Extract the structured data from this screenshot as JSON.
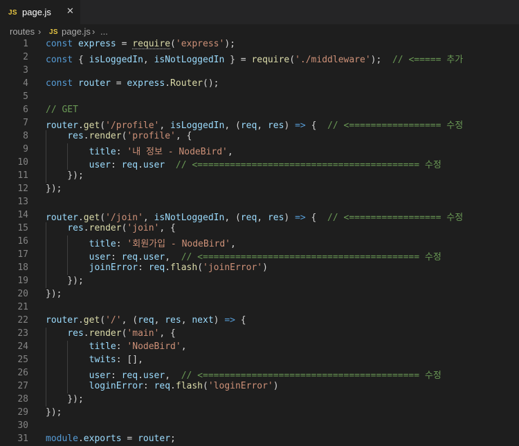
{
  "tab": {
    "icon": "JS",
    "label": "page.js",
    "close": "✕"
  },
  "breadcrumb": {
    "folder": "routes",
    "sep1": "›",
    "icon": "JS",
    "file": "page.js",
    "sep2": "›",
    "more": "..."
  },
  "colors": {
    "background": "#1e1e1e",
    "keyword": "#569cd6",
    "variable": "#9cdcfe",
    "function": "#dcdcaa",
    "string": "#ce9178",
    "comment": "#6a9955",
    "text": "#d4d4d4"
  },
  "lines": [
    {
      "n": "1",
      "t": [
        [
          "kw",
          "const "
        ],
        [
          "var",
          "express"
        ],
        [
          "pl",
          " = "
        ],
        [
          "fn",
          "require",
          "squig"
        ],
        [
          "pl",
          "("
        ],
        [
          "str",
          "'express'"
        ],
        [
          "pl",
          ");"
        ]
      ]
    },
    {
      "n": "2",
      "t": [
        [
          "kw",
          "const "
        ],
        [
          "pl",
          "{ "
        ],
        [
          "var",
          "isLoggedIn"
        ],
        [
          "pl",
          ", "
        ],
        [
          "var",
          "isNotLoggedIn"
        ],
        [
          "pl",
          " } = "
        ],
        [
          "fn",
          "require"
        ],
        [
          "pl",
          "("
        ],
        [
          "str",
          "'./middleware'"
        ],
        [
          "pl",
          ");  "
        ],
        [
          "cm",
          "// <===== 추가"
        ]
      ]
    },
    {
      "n": "3",
      "t": []
    },
    {
      "n": "4",
      "t": [
        [
          "kw",
          "const "
        ],
        [
          "var",
          "router"
        ],
        [
          "pl",
          " = "
        ],
        [
          "var",
          "express"
        ],
        [
          "pl",
          "."
        ],
        [
          "fn",
          "Router"
        ],
        [
          "pl",
          "();"
        ]
      ]
    },
    {
      "n": "5",
      "t": []
    },
    {
      "n": "6",
      "t": [
        [
          "cm",
          "// GET"
        ]
      ]
    },
    {
      "n": "7",
      "t": [
        [
          "var",
          "router"
        ],
        [
          "pl",
          "."
        ],
        [
          "fn",
          "get"
        ],
        [
          "pl",
          "("
        ],
        [
          "str",
          "'/profile'"
        ],
        [
          "pl",
          ", "
        ],
        [
          "var",
          "isLoggedIn"
        ],
        [
          "pl",
          ", ("
        ],
        [
          "var",
          "req"
        ],
        [
          "pl",
          ", "
        ],
        [
          "var",
          "res"
        ],
        [
          "pl",
          ") "
        ],
        [
          "kw",
          "=>"
        ],
        [
          "pl",
          " {  "
        ],
        [
          "cm",
          "// <================= 수정"
        ]
      ]
    },
    {
      "n": "8",
      "t": [
        [
          "pl",
          "    "
        ],
        [
          "var",
          "res"
        ],
        [
          "pl",
          "."
        ],
        [
          "fn",
          "render"
        ],
        [
          "pl",
          "("
        ],
        [
          "str",
          "'profile'"
        ],
        [
          "pl",
          ", {"
        ]
      ]
    },
    {
      "n": "9",
      "t": [
        [
          "pl",
          "        "
        ],
        [
          "var",
          "title"
        ],
        [
          "pl",
          ": "
        ],
        [
          "str",
          "'내 정보 - NodeBird'"
        ],
        [
          "pl",
          ","
        ]
      ]
    },
    {
      "n": "10",
      "t": [
        [
          "pl",
          "        "
        ],
        [
          "var",
          "user"
        ],
        [
          "pl",
          ": "
        ],
        [
          "var",
          "req"
        ],
        [
          "pl",
          "."
        ],
        [
          "var",
          "user"
        ],
        [
          "pl",
          "  "
        ],
        [
          "cm",
          "// <========================================= 수정"
        ]
      ]
    },
    {
      "n": "11",
      "t": [
        [
          "pl",
          "    });"
        ]
      ]
    },
    {
      "n": "12",
      "t": [
        [
          "pl",
          "});"
        ]
      ]
    },
    {
      "n": "13",
      "t": []
    },
    {
      "n": "14",
      "t": [
        [
          "var",
          "router"
        ],
        [
          "pl",
          "."
        ],
        [
          "fn",
          "get"
        ],
        [
          "pl",
          "("
        ],
        [
          "str",
          "'/join'"
        ],
        [
          "pl",
          ", "
        ],
        [
          "var",
          "isNotLoggedIn"
        ],
        [
          "pl",
          ", ("
        ],
        [
          "var",
          "req"
        ],
        [
          "pl",
          ", "
        ],
        [
          "var",
          "res"
        ],
        [
          "pl",
          ") "
        ],
        [
          "kw",
          "=>"
        ],
        [
          "pl",
          " {  "
        ],
        [
          "cm",
          "// <================= 수정"
        ]
      ]
    },
    {
      "n": "15",
      "t": [
        [
          "pl",
          "    "
        ],
        [
          "var",
          "res"
        ],
        [
          "pl",
          "."
        ],
        [
          "fn",
          "render"
        ],
        [
          "pl",
          "("
        ],
        [
          "str",
          "'join'"
        ],
        [
          "pl",
          ", {"
        ]
      ]
    },
    {
      "n": "16",
      "t": [
        [
          "pl",
          "        "
        ],
        [
          "var",
          "title"
        ],
        [
          "pl",
          ": "
        ],
        [
          "str",
          "'회원가입 - NodeBird'"
        ],
        [
          "pl",
          ","
        ]
      ]
    },
    {
      "n": "17",
      "t": [
        [
          "pl",
          "        "
        ],
        [
          "var",
          "user"
        ],
        [
          "pl",
          ": "
        ],
        [
          "var",
          "req"
        ],
        [
          "pl",
          "."
        ],
        [
          "var",
          "user"
        ],
        [
          "pl",
          ",  "
        ],
        [
          "cm",
          "// <======================================== 수정"
        ]
      ]
    },
    {
      "n": "18",
      "t": [
        [
          "pl",
          "        "
        ],
        [
          "var",
          "joinError"
        ],
        [
          "pl",
          ": "
        ],
        [
          "var",
          "req"
        ],
        [
          "pl",
          "."
        ],
        [
          "fn",
          "flash"
        ],
        [
          "pl",
          "("
        ],
        [
          "str",
          "'joinError'"
        ],
        [
          "pl",
          ")"
        ]
      ]
    },
    {
      "n": "19",
      "t": [
        [
          "pl",
          "    });"
        ]
      ]
    },
    {
      "n": "20",
      "t": [
        [
          "pl",
          "});"
        ]
      ]
    },
    {
      "n": "21",
      "t": []
    },
    {
      "n": "22",
      "t": [
        [
          "var",
          "router"
        ],
        [
          "pl",
          "."
        ],
        [
          "fn",
          "get"
        ],
        [
          "pl",
          "("
        ],
        [
          "str",
          "'/'"
        ],
        [
          "pl",
          ", ("
        ],
        [
          "var",
          "req"
        ],
        [
          "pl",
          ", "
        ],
        [
          "var",
          "res"
        ],
        [
          "pl",
          ", "
        ],
        [
          "var",
          "next"
        ],
        [
          "pl",
          ") "
        ],
        [
          "kw",
          "=>"
        ],
        [
          "pl",
          " {"
        ]
      ]
    },
    {
      "n": "23",
      "t": [
        [
          "pl",
          "    "
        ],
        [
          "var",
          "res"
        ],
        [
          "pl",
          "."
        ],
        [
          "fn",
          "render"
        ],
        [
          "pl",
          "("
        ],
        [
          "str",
          "'main'"
        ],
        [
          "pl",
          ", {"
        ]
      ]
    },
    {
      "n": "24",
      "t": [
        [
          "pl",
          "        "
        ],
        [
          "var",
          "title"
        ],
        [
          "pl",
          ": "
        ],
        [
          "str",
          "'NodeBird'"
        ],
        [
          "pl",
          ","
        ]
      ]
    },
    {
      "n": "25",
      "t": [
        [
          "pl",
          "        "
        ],
        [
          "var",
          "twits"
        ],
        [
          "pl",
          ": [],"
        ]
      ]
    },
    {
      "n": "26",
      "t": [
        [
          "pl",
          "        "
        ],
        [
          "var",
          "user"
        ],
        [
          "pl",
          ": "
        ],
        [
          "var",
          "req"
        ],
        [
          "pl",
          "."
        ],
        [
          "var",
          "user"
        ],
        [
          "pl",
          ",  "
        ],
        [
          "cm",
          "// <======================================== 수정"
        ]
      ]
    },
    {
      "n": "27",
      "t": [
        [
          "pl",
          "        "
        ],
        [
          "var",
          "loginError"
        ],
        [
          "pl",
          ": "
        ],
        [
          "var",
          "req"
        ],
        [
          "pl",
          "."
        ],
        [
          "fn",
          "flash"
        ],
        [
          "pl",
          "("
        ],
        [
          "str",
          "'loginError'"
        ],
        [
          "pl",
          ")"
        ]
      ]
    },
    {
      "n": "28",
      "t": [
        [
          "pl",
          "    });"
        ]
      ]
    },
    {
      "n": "29",
      "t": [
        [
          "pl",
          "});"
        ]
      ]
    },
    {
      "n": "30",
      "t": []
    },
    {
      "n": "31",
      "t": [
        [
          "kw",
          "module"
        ],
        [
          "pl",
          "."
        ],
        [
          "var",
          "exports"
        ],
        [
          "pl",
          " = "
        ],
        [
          "var",
          "router"
        ],
        [
          "pl",
          ";"
        ]
      ]
    }
  ]
}
